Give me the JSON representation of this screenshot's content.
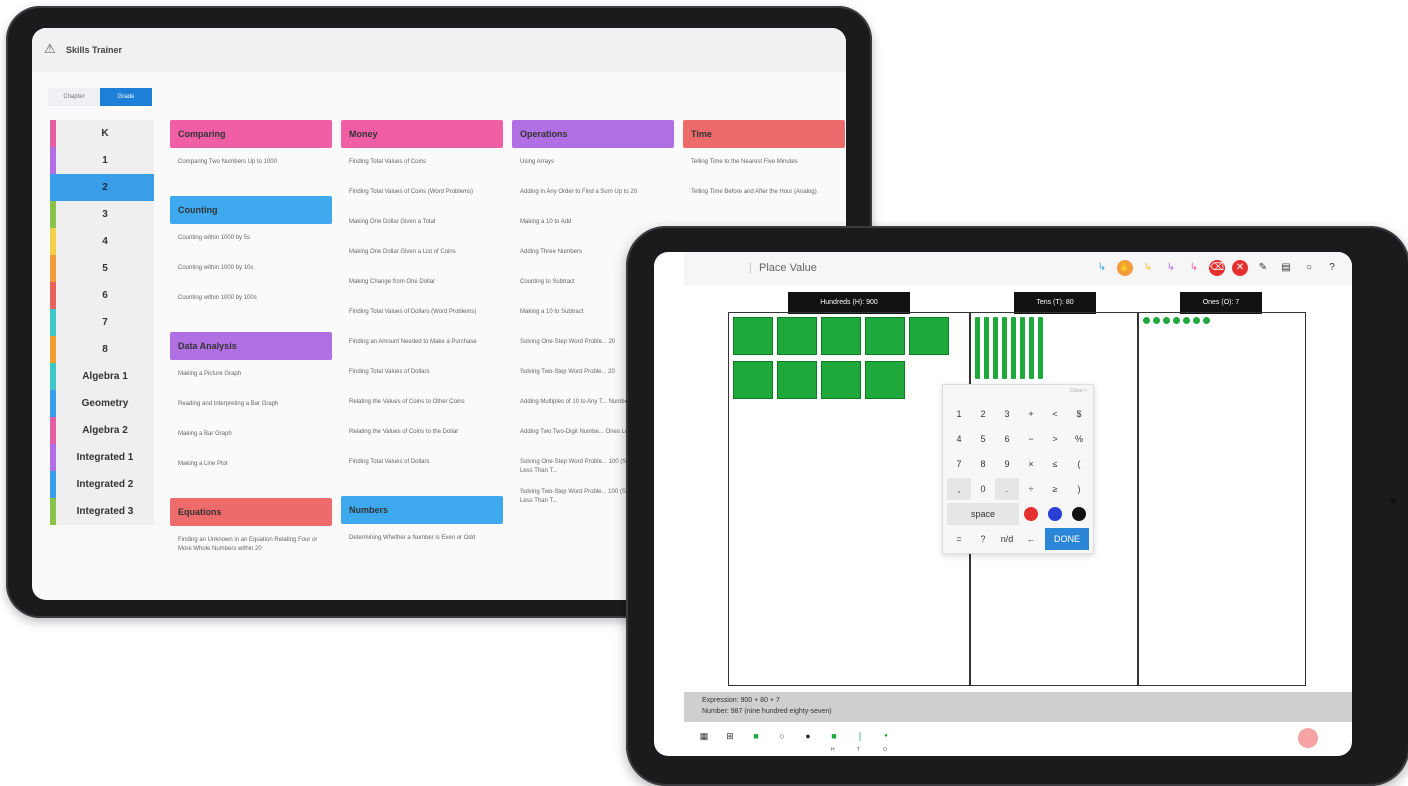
{
  "skills_trainer": {
    "app_title": "Skills Trainer",
    "toggle": {
      "chapter": "Chapter",
      "grade": "Grade"
    },
    "grades": [
      {
        "label": "K",
        "color": "#e25fa6"
      },
      {
        "label": "1",
        "color": "#b06fe2"
      },
      {
        "label": "2",
        "color": "#3a9ee8",
        "selected": true
      },
      {
        "label": "3",
        "color": "#8bc34a"
      },
      {
        "label": "4",
        "color": "#f5d04a"
      },
      {
        "label": "5",
        "color": "#f39a3c"
      },
      {
        "label": "6",
        "color": "#e6635b"
      },
      {
        "label": "7",
        "color": "#3ec7c9"
      },
      {
        "label": "8",
        "color": "#f0a030"
      },
      {
        "label": "Algebra 1",
        "color": "#3ec7c9"
      },
      {
        "label": "Geometry",
        "color": "#3a9ee8"
      },
      {
        "label": "Algebra 2",
        "color": "#e25fa6"
      },
      {
        "label": "Integrated 1",
        "color": "#b06fe2"
      },
      {
        "label": "Integrated 2",
        "color": "#3a9ee8"
      },
      {
        "label": "Integrated 3",
        "color": "#8bc34a"
      }
    ],
    "columns": [
      {
        "sections": [
          {
            "title": "Comparing",
            "color": "#f05fa6",
            "lessons": [
              "Comparing Two Numbers Up to 1000"
            ]
          },
          {
            "title": "Counting",
            "color": "#3fa9ef",
            "lessons": [
              "Counting within 1000 by 5s",
              "Counting within 1000 by 10s",
              "Counting within 1000 by 100s"
            ]
          },
          {
            "title": "Data Analysis",
            "color": "#b06fe2",
            "lessons": [
              "Making a Picture Graph",
              "Reading and Interpreting a Bar Graph",
              "Making a Bar Graph",
              "Making a Line Plot"
            ]
          },
          {
            "title": "Equations",
            "color": "#ee6b6b",
            "lessons": [
              "Finding an Unknown in an Equation Relating Four or More Whole Numbers within 20"
            ]
          }
        ]
      },
      {
        "sections": [
          {
            "title": "Money",
            "color": "#f05fa6",
            "lessons": [
              "Finding Total Values of Coins",
              "Finding Total Values of Coins (Word Problems)",
              "Making One Dollar Given a Total",
              "Making One Dollar Given a List of Coins",
              "Making Change from One Dollar",
              "Finding Total Values of Dollars (Word Problems)",
              "Finding an Amount Needed to Make a Purchase",
              "Finding Total Values of Dollars",
              "Relating the Values of Coins to Other Coins",
              "Relating the Values of Coins to the Dollar",
              "Finding Total Values of Dollars"
            ]
          },
          {
            "title": "Numbers",
            "color": "#3fa9ef",
            "lessons": [
              "Determining Whether a Number is Even or Odd"
            ]
          }
        ]
      },
      {
        "sections": [
          {
            "title": "Operations",
            "color": "#b06fe2",
            "lessons": [
              "Using Arrays",
              "Adding in Any Order to Find a Sum Up to 20",
              "Making a 10 to Add",
              "Adding Three Numbers",
              "Counting to Subtract",
              "Making a 10 to Subtract",
              "Solving One-Step Word Proble... 20",
              "Solving Two-Step Word Proble... 20",
              "Adding Multiples of 10 to Any T... Number",
              "Adding Two Two-Digit Numbe... Ones Less Than Ten",
              "Solving One-Step Word Proble... 100 (Sum of Ones Less Than T...",
              "Solving Two-Step Word Proble... 100 (Sum of Ones Less Than T..."
            ]
          }
        ]
      },
      {
        "sections": [
          {
            "title": "Time",
            "color": "#ee6b6b",
            "lessons": [
              "Telling Time to the Nearest Five Minutes",
              "Telling Time Before and After the Hour (Analog)"
            ]
          }
        ]
      }
    ]
  },
  "place_value": {
    "title": "Place Value",
    "headers": [
      "Hundreds (H): 900",
      "Tens (T): 80",
      "Ones (O): 7"
    ],
    "hundreds_count": 9,
    "tens_count": 8,
    "ones_count": 7,
    "keypad": {
      "close": "Close ×",
      "rows": [
        [
          "1",
          "2",
          "3",
          "+",
          "<",
          "$"
        ],
        [
          "4",
          "5",
          "6",
          "−",
          ">",
          "%"
        ],
        [
          "7",
          "8",
          "9",
          "×",
          "≤",
          "("
        ],
        [
          ",",
          "0",
          ".",
          "÷",
          "≥",
          ")"
        ]
      ],
      "space": "space",
      "colors": [
        "#e53030",
        "#2a3fd6",
        "#111111"
      ],
      "last_row": [
        "=",
        "?",
        "n/d",
        "←"
      ],
      "done": "DONE"
    },
    "expression": "Expression:  900 + 80 + 7",
    "number": "Number:  987 (nine hundred eighty-seven)",
    "bottom_sub_labels": [
      "H",
      "T",
      "O"
    ]
  }
}
